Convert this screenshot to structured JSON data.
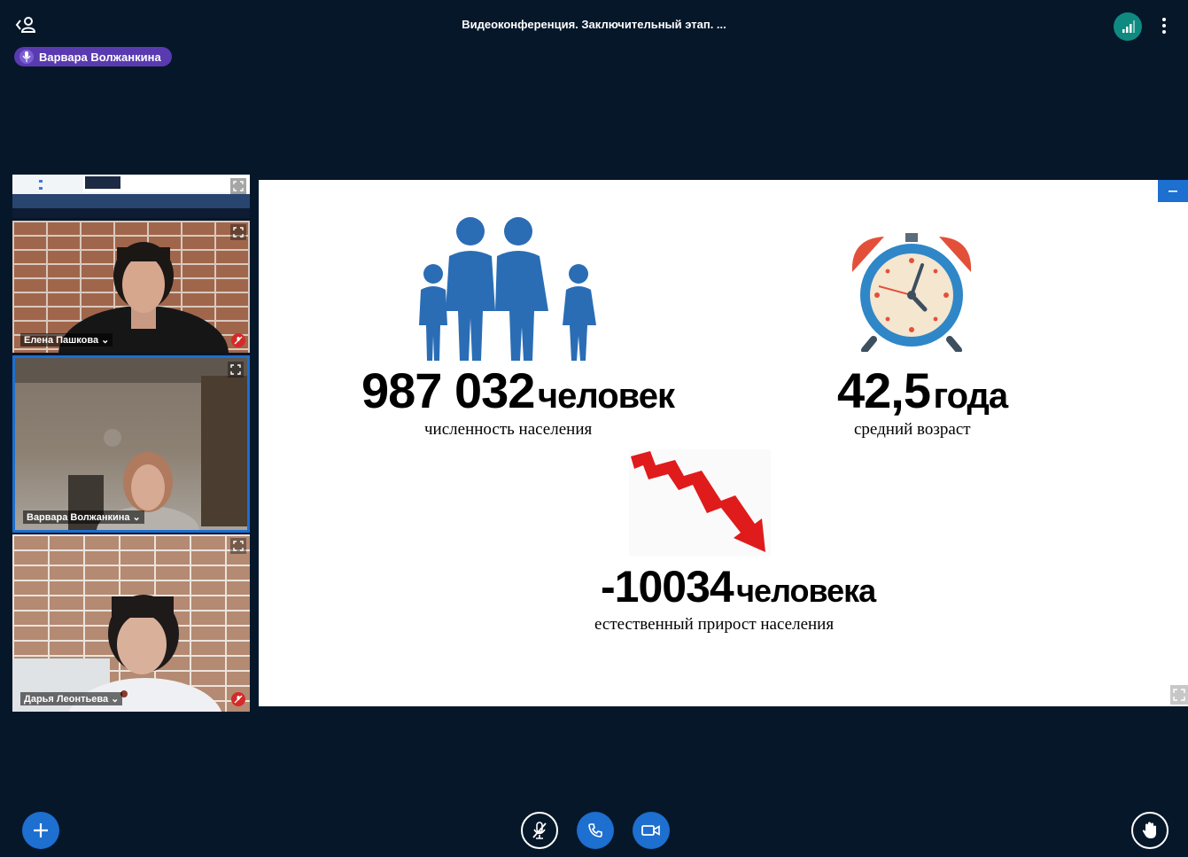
{
  "header": {
    "title": "Видеоконференция. Заключительный этап. ...",
    "users_toggle_icon": "user-list-icon",
    "connection_icon": "signal-bars-icon",
    "more_icon": "vertical-ellipsis-icon"
  },
  "talking_indicator": {
    "name": "Варвара Волжанкина",
    "icon": "microphone-icon"
  },
  "participants": [
    {
      "name": "Елена Пашкова",
      "muted": true
    },
    {
      "name": "Варвара Волжанкина",
      "muted": false,
      "active": true
    },
    {
      "name": "Дарья Леонтьева",
      "muted": true
    }
  ],
  "slide": {
    "population": {
      "value": "987 032",
      "unit": "человек",
      "caption": "численность населения"
    },
    "median_age": {
      "value": "42,5",
      "unit": "года",
      "caption": "средний возраст"
    },
    "natural_growth": {
      "value": "-10034",
      "unit": "человека",
      "caption": "естественный прирост населения"
    }
  },
  "controls": {
    "actions_icon": "plus-icon",
    "mic_icon": "microphone-muted-icon",
    "phone_icon": "phone-icon",
    "video_icon": "video-camera-icon",
    "raise_hand_icon": "hand-icon"
  },
  "colors": {
    "background": "#06172a",
    "accent_blue": "#1d6fd0",
    "talker_pill": "#5a3ab0",
    "connection_ok": "#0f8a80",
    "muted_red": "#d52a2a",
    "family_blue": "#2a6db5",
    "arrow_red": "#e01b1b"
  }
}
